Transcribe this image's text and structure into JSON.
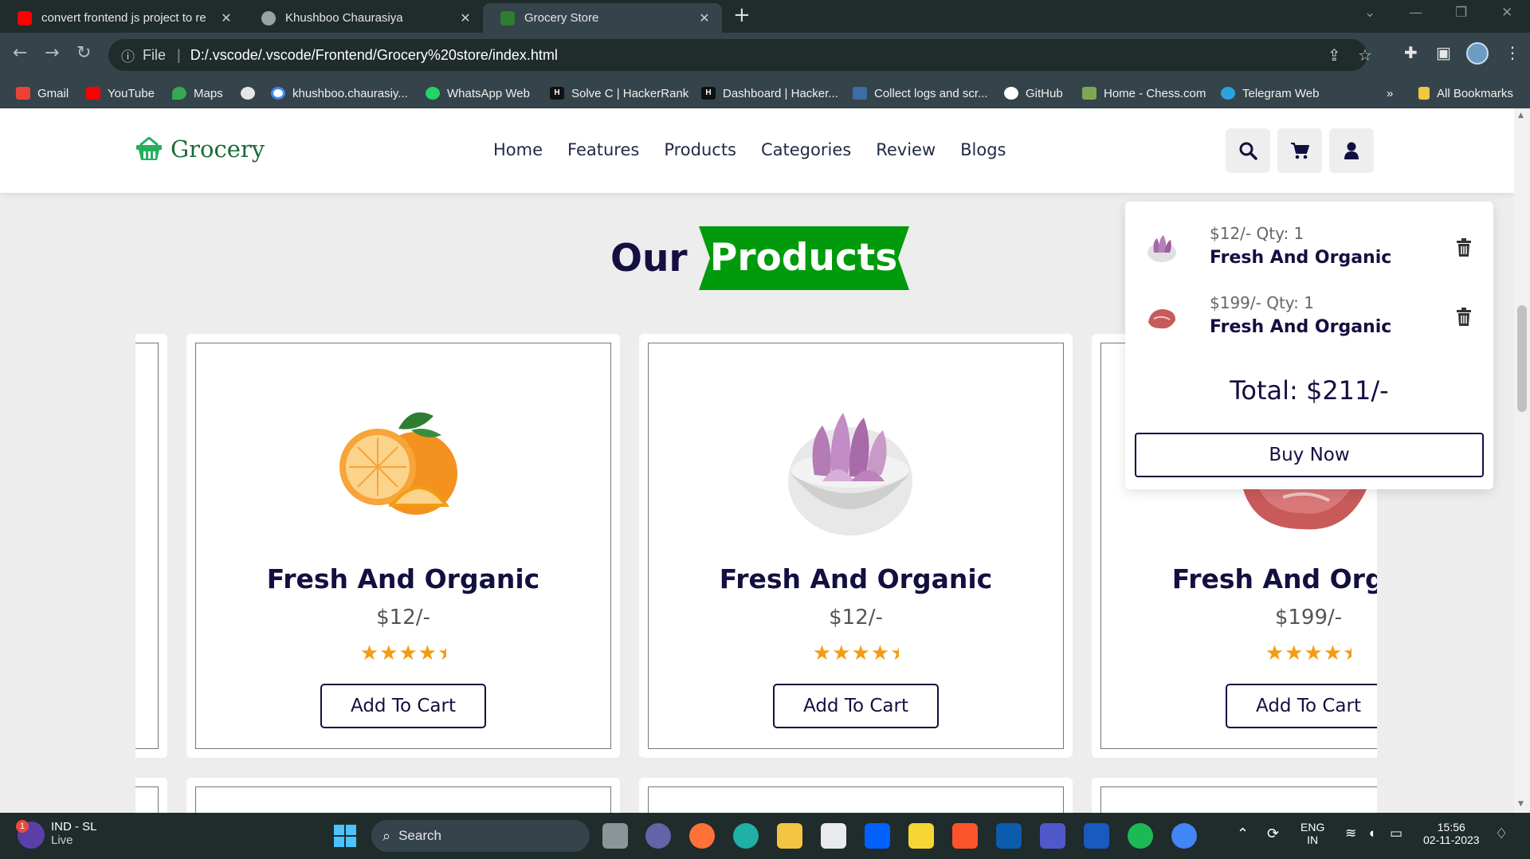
{
  "browser": {
    "tabs": [
      {
        "title": "convert frontend js project to re",
        "favicon": "youtube-icon",
        "color": "#ff0000"
      },
      {
        "title": "Khushboo Chaurasiya",
        "favicon": "globe-icon",
        "color": "#9aa0a6"
      },
      {
        "title": "Grocery Store",
        "favicon": "basket-icon",
        "color": "#2e7d32",
        "active": true
      }
    ],
    "new_tab_label": "+",
    "address": {
      "scheme_label": "File",
      "url": "D:/.vscode/.vscode/Frontend/Grocery%20store/index.html"
    },
    "bookmarks": [
      {
        "label": "Gmail",
        "icon": "gmail-icon",
        "color": "#ea4335"
      },
      {
        "label": "YouTube",
        "icon": "youtube-icon",
        "color": "#ff0000"
      },
      {
        "label": "Maps",
        "icon": "maps-icon",
        "color": "#34a853"
      },
      {
        "label": "",
        "icon": "globe-icon",
        "color": "#e6e6e6"
      },
      {
        "label": "khushboo.chaurasiy...",
        "icon": "google-icon",
        "color": "#4285f4"
      },
      {
        "label": "WhatsApp Web",
        "icon": "whatsapp-icon",
        "color": "#25d366"
      },
      {
        "label": "Solve C | HackerRank",
        "icon": "hackerrank-icon",
        "color": "#111111"
      },
      {
        "label": "Dashboard | Hacker...",
        "icon": "hackerrank-icon",
        "color": "#111111"
      },
      {
        "label": "Collect logs and scr...",
        "icon": "logs-icon",
        "color": "#3b6ea5"
      },
      {
        "label": "GitHub",
        "icon": "github-icon",
        "color": "#ffffff"
      },
      {
        "label": "Home - Chess.com",
        "icon": "chess-icon",
        "color": "#7fa650"
      },
      {
        "label": "Telegram Web",
        "icon": "telegram-icon",
        "color": "#2aa3df"
      }
    ],
    "more_bookmarks": "»",
    "all_bookmarks": "All Bookmarks"
  },
  "site": {
    "logo_text": "Grocery",
    "brand_color": "#27ae60",
    "nav": [
      "Home",
      "Features",
      "Products",
      "Categories",
      "Review",
      "Blogs"
    ],
    "header_buttons": [
      "search-icon",
      "cart-icon",
      "user-icon"
    ],
    "heading": {
      "plain": "Our",
      "highlight": "Products"
    },
    "products": [
      {
        "name": "Fresh And Organic",
        "price": "$12/-",
        "rating": 4.5,
        "button": "Add To Cart",
        "image": "orange-image"
      },
      {
        "name": "Fresh And Organic",
        "price": "$12/-",
        "rating": 4.5,
        "button": "Add To Cart",
        "image": "onion-image"
      },
      {
        "name": "Fresh And Organic",
        "price": "$199/-",
        "rating": 4.5,
        "button": "Add To Cart",
        "image": "meat-image"
      }
    ],
    "cart": {
      "items": [
        {
          "price_qty": "$12/- Qty: 1",
          "name": "Fresh And Organic",
          "image": "onion-image"
        },
        {
          "price_qty": "$199/- Qty: 1",
          "name": "Fresh And Organic",
          "image": "meat-image"
        }
      ],
      "total": "Total: $211/-",
      "buy_label": "Buy Now"
    }
  },
  "taskbar": {
    "weather": {
      "line1": "IND - SL",
      "line2": "Live",
      "badge": "1"
    },
    "search_label": "Search",
    "lang": {
      "line1": "ENG",
      "line2": "IN"
    },
    "clock": {
      "time": "15:56",
      "date": "02-11-2023"
    }
  }
}
